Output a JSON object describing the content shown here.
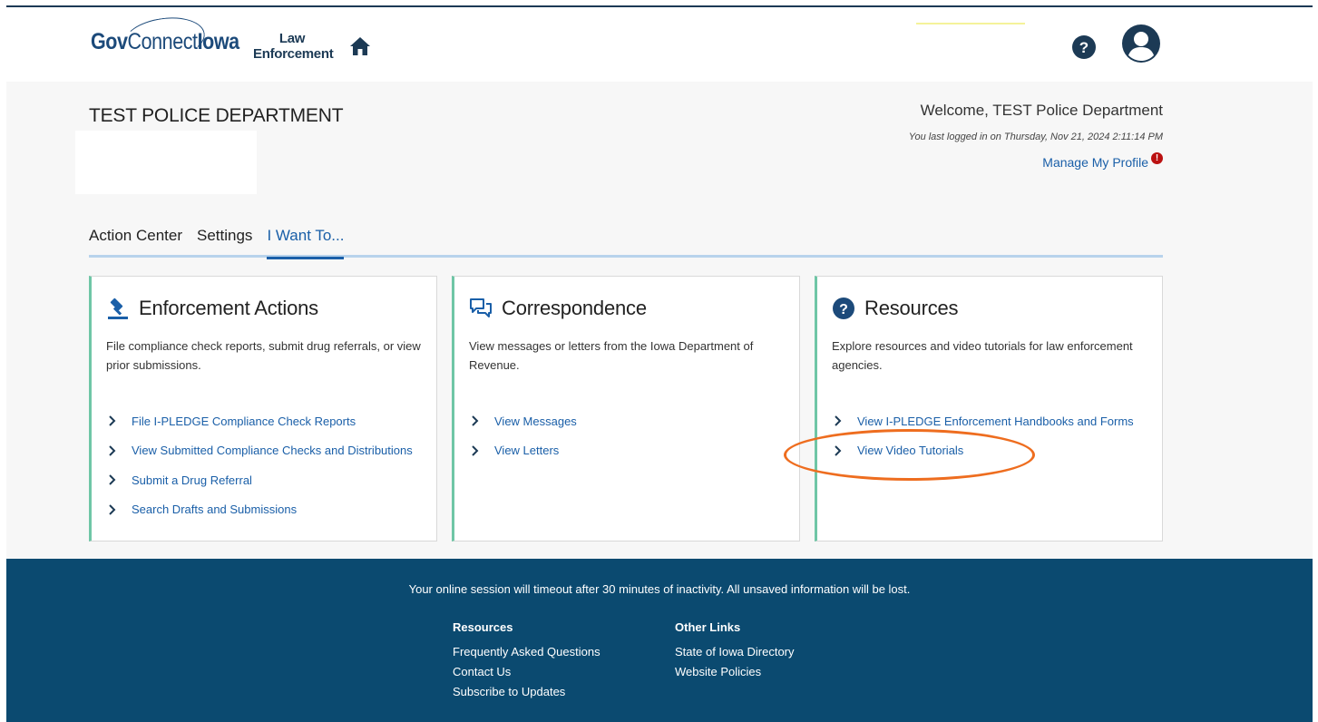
{
  "header": {
    "logo_text_a": "Gov",
    "logo_text_b": "Connect",
    "logo_text_c": "Iowa",
    "app_line1": "Law",
    "app_line2": "Enforcement"
  },
  "account": {
    "department": "TEST POLICE DEPARTMENT",
    "welcome": "Welcome, TEST Police Department",
    "last_login": "You last logged in on Thursday, Nov 21, 2024 2:11:14 PM",
    "profile_link": "Manage My Profile",
    "alert_badge": "!"
  },
  "tabs": [
    {
      "label": "Action Center",
      "active": false
    },
    {
      "label": "Settings",
      "active": false
    },
    {
      "label": "I Want To...",
      "active": true
    }
  ],
  "cards": [
    {
      "icon": "gavel-icon",
      "title": "Enforcement Actions",
      "description": "File compliance check reports, submit drug referrals, or view prior submissions.",
      "links": [
        "File I-PLEDGE Compliance Check Reports",
        "View Submitted Compliance Checks and Distributions",
        "Submit a Drug Referral",
        "Search Drafts and Submissions"
      ]
    },
    {
      "icon": "chat-bubbles-icon",
      "title": "Correspondence",
      "description": "View messages or letters from the Iowa Department of Revenue.",
      "links": [
        "View Messages",
        "View Letters"
      ]
    },
    {
      "icon": "question-circle-icon",
      "title": "Resources",
      "description": "Explore resources and video tutorials for law enforcement agencies.",
      "links": [
        "View I-PLEDGE Enforcement Handbooks and Forms",
        "View Video Tutorials"
      ]
    }
  ],
  "footer": {
    "timeout_notice": "Your online session will timeout after 30 minutes of inactivity. All unsaved information will be lost.",
    "resources_heading": "Resources",
    "resources_links": [
      "Frequently Asked Questions",
      "Contact Us",
      "Subscribe to Updates"
    ],
    "other_heading": "Other Links",
    "other_links": [
      "State of Iowa Directory",
      "Website Policies"
    ]
  },
  "colors": {
    "brand_blue": "#1a5fa8",
    "footer_bg": "#0b4a70",
    "card_accent": "#6fc6a6",
    "annotation": "#ee6d1f"
  }
}
